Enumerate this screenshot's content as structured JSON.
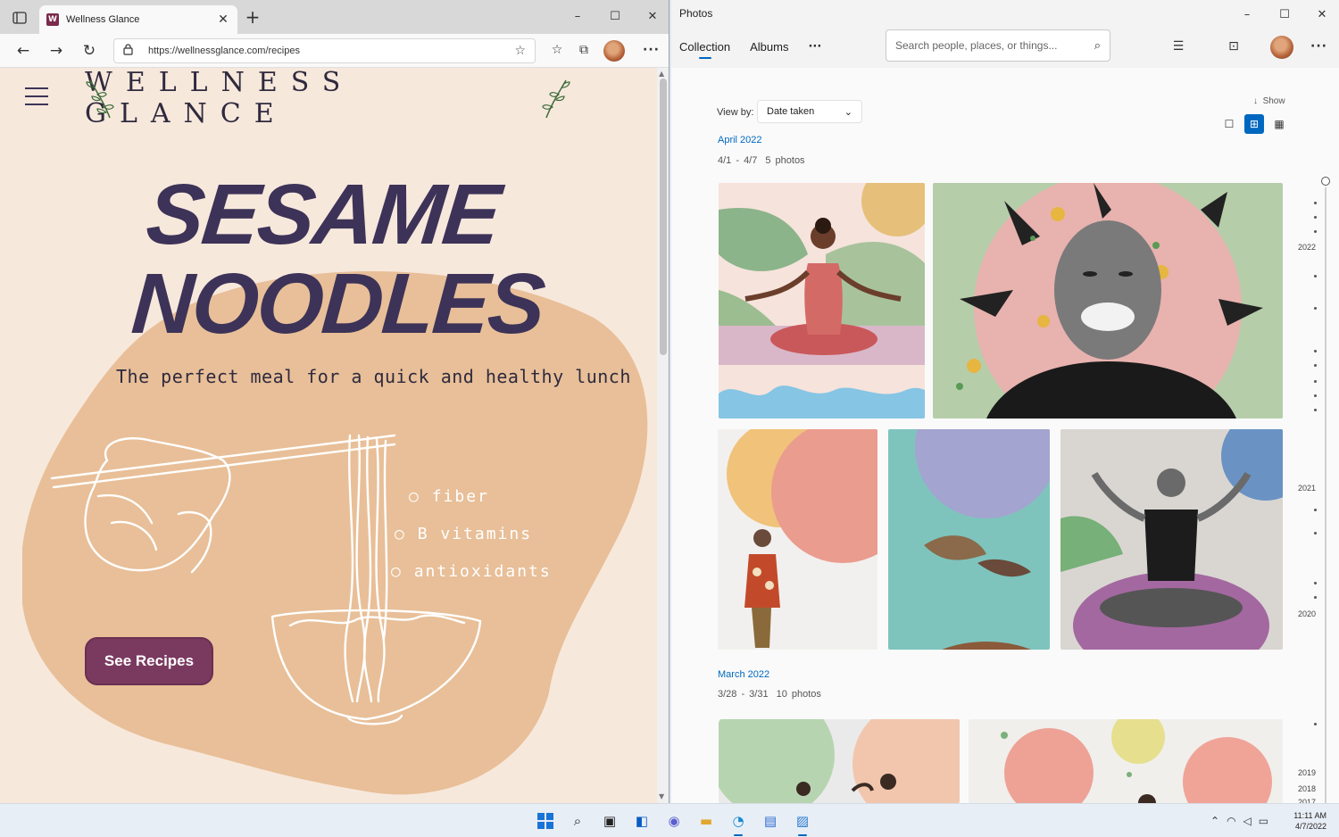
{
  "browser": {
    "tab_title": "Wellness Glance",
    "favicon_letter": "W",
    "url": "https://wellnessglance.com/recipes",
    "icons": [
      "tab-actions-icon",
      "back-icon",
      "forward-icon",
      "refresh-icon",
      "lock-icon",
      "add-favorite-icon",
      "favorites-icon",
      "collections-icon",
      "profile-avatar",
      "more-icon"
    ]
  },
  "webpage": {
    "brand": "WELLNESS GLANCE",
    "headline_line1": "SESAME",
    "headline_line2": "NOODLES",
    "tagline": "The perfect meal for a quick and healthy lunch",
    "bullets": [
      "fiber",
      "B vitamins",
      "antioxidants"
    ],
    "cta_label": "See Recipes",
    "colors": {
      "background": "#f7e8dc",
      "blob": "#e8bf98",
      "headline": "#3d3358",
      "cta": "#7a3a60"
    }
  },
  "photos": {
    "app_title": "Photos",
    "nav": [
      "Collection",
      "Albums"
    ],
    "search_placeholder": "Search people, places, or things...",
    "view_by_label": "View by:",
    "view_by_value": "Date taken",
    "show_label": "Show",
    "groups": [
      {
        "month": "April 2022",
        "range": "4/1 - 4/7",
        "count": "5 photos"
      },
      {
        "month": "March 2022",
        "range": "3/28 - 3/31",
        "count": "10 photos"
      }
    ],
    "timeline_years": [
      "2022",
      "2021",
      "2020",
      "2019",
      "2018",
      "2017"
    ],
    "accent": "#0067c0"
  },
  "taskbar": {
    "time": "11:11 AM",
    "date": "4/7/2022",
    "apps": [
      "start-icon",
      "search-icon",
      "task-view-icon",
      "widgets-icon",
      "chat-icon",
      "file-explorer-icon",
      "edge-icon",
      "store-icon",
      "photos-icon"
    ]
  }
}
